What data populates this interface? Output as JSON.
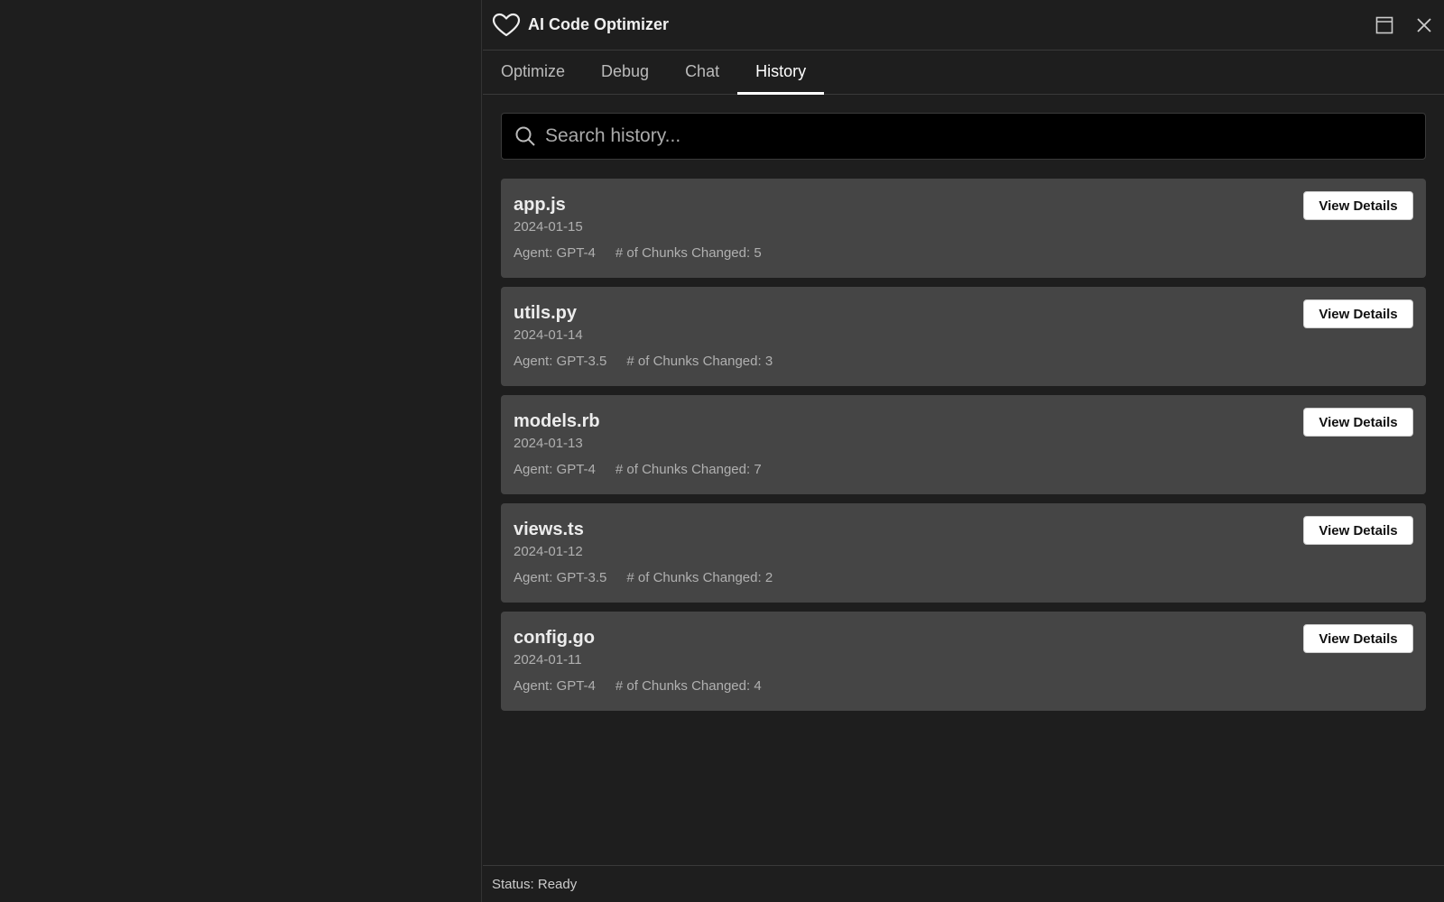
{
  "header": {
    "title": "AI Code Optimizer"
  },
  "tabs": [
    {
      "label": "Optimize"
    },
    {
      "label": "Debug"
    },
    {
      "label": "Chat"
    },
    {
      "label": "History"
    }
  ],
  "search": {
    "placeholder": "Search history...",
    "value": ""
  },
  "history": [
    {
      "name": "app.js",
      "date": "2024-01-15",
      "agent": "Agent: GPT-4",
      "chunks": "# of Chunks Changed: 5",
      "button": "View Details"
    },
    {
      "name": "utils.py",
      "date": "2024-01-14",
      "agent": "Agent: GPT-3.5",
      "chunks": "# of Chunks Changed: 3",
      "button": "View Details"
    },
    {
      "name": "models.rb",
      "date": "2024-01-13",
      "agent": "Agent: GPT-4",
      "chunks": "# of Chunks Changed: 7",
      "button": "View Details"
    },
    {
      "name": "views.ts",
      "date": "2024-01-12",
      "agent": "Agent: GPT-3.5",
      "chunks": "# of Chunks Changed: 2",
      "button": "View Details"
    },
    {
      "name": "config.go",
      "date": "2024-01-11",
      "agent": "Agent: GPT-4",
      "chunks": "# of Chunks Changed: 4",
      "button": "View Details"
    }
  ],
  "status": "Status: Ready"
}
